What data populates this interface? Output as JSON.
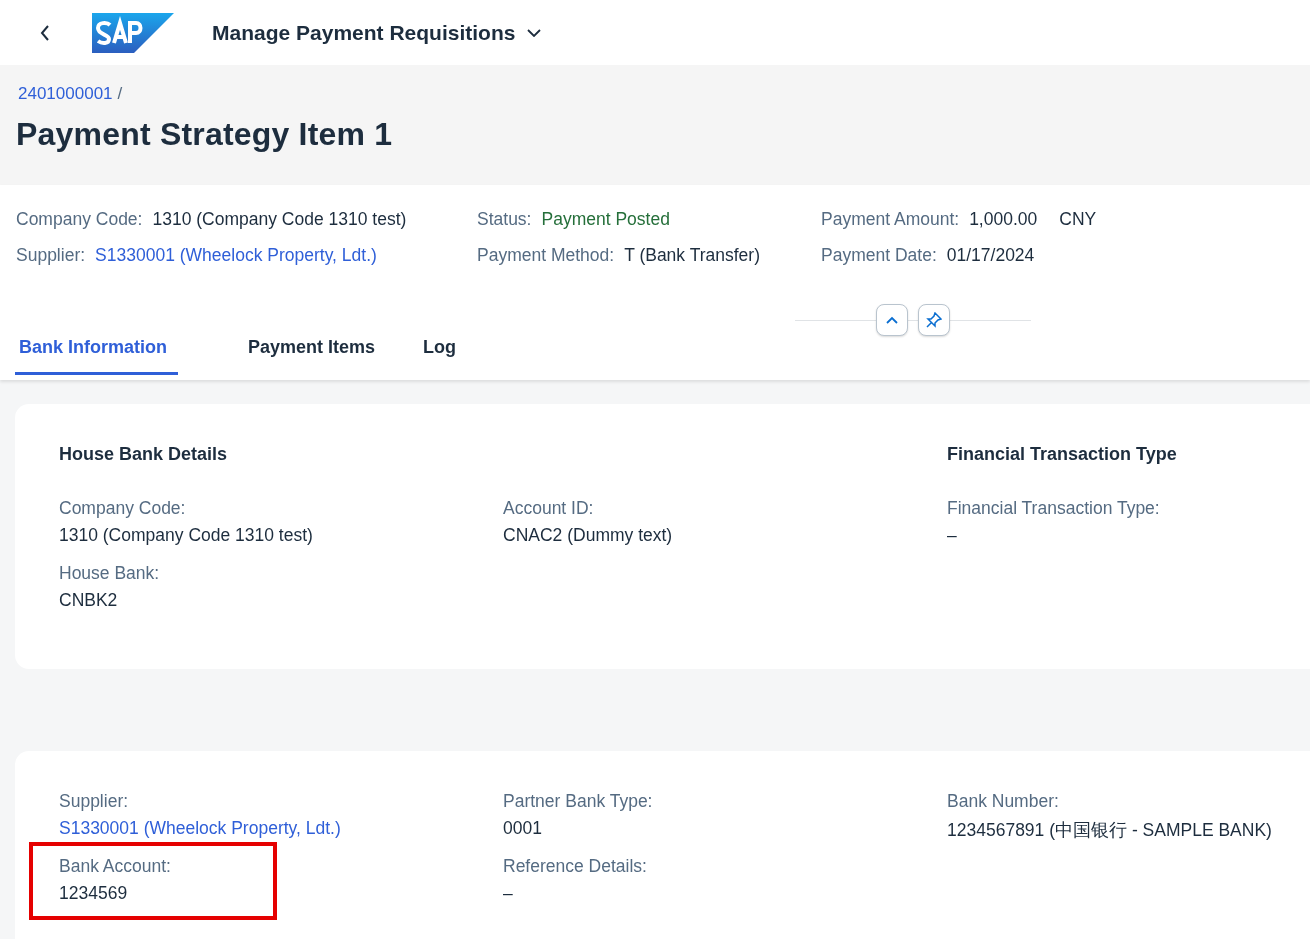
{
  "app_bar": {
    "title": "Manage Payment Requisitions"
  },
  "breadcrumb": {
    "link": "2401000001",
    "separator": "/"
  },
  "page_title": "Payment Strategy Item 1",
  "header_fields": [
    [
      {
        "label": "Company Code:",
        "value": "1310 (Company Code 1310 test)",
        "kind": "text"
      },
      {
        "label": "Supplier:",
        "value": "S1330001 (Wheelock Property, Ldt.)",
        "kind": "link"
      }
    ],
    [
      {
        "label": "Status:",
        "value": "Payment Posted",
        "kind": "status"
      },
      {
        "label": "Payment Method:",
        "value": "T (Bank Transfer)",
        "kind": "text"
      }
    ],
    [
      {
        "label": "Payment Amount:",
        "value": "1,000.00",
        "unit": "CNY",
        "kind": "text"
      },
      {
        "label": "Payment Date:",
        "value": "01/17/2024",
        "kind": "text"
      }
    ]
  ],
  "tabs": [
    {
      "label": "Bank Information",
      "selected": true
    },
    {
      "label": "Payment Items",
      "selected": false
    },
    {
      "label": "Log",
      "selected": false
    }
  ],
  "cards": [
    {
      "columns": [
        {
          "heading": "House Bank Details",
          "fields": [
            {
              "label": "Company Code:",
              "value": "1310 (Company Code 1310 test)",
              "kind": "text",
              "highlighted": false
            },
            {
              "label": "House Bank:",
              "value": "CNBK2",
              "kind": "text",
              "highlighted": false
            }
          ]
        },
        {
          "fields": [
            {
              "label": "Account ID:",
              "value": "CNAC2 (Dummy text)",
              "kind": "text",
              "highlighted": false
            }
          ]
        },
        {
          "heading": "Financial Transaction Type",
          "fields": [
            {
              "label": "Financial Transaction Type:",
              "value": "–",
              "kind": "text",
              "highlighted": false
            }
          ]
        }
      ]
    },
    {
      "columns": [
        {
          "fields": [
            {
              "label": "Supplier:",
              "value": "S1330001 (Wheelock Property, Ldt.)",
              "kind": "link",
              "highlighted": false
            },
            {
              "label": "Bank Account:",
              "value": "1234569",
              "kind": "text",
              "highlighted": true
            }
          ]
        },
        {
          "fields": [
            {
              "label": "Partner Bank Type:",
              "value": "0001",
              "kind": "text",
              "highlighted": false
            },
            {
              "label": "Reference Details:",
              "value": "–",
              "kind": "text",
              "highlighted": false
            }
          ]
        },
        {
          "fields": [
            {
              "label": "Bank Number:",
              "value": "1234567891 (中国银行 - SAMPLE BANK)",
              "kind": "text",
              "highlighted": false
            }
          ]
        }
      ]
    }
  ]
}
